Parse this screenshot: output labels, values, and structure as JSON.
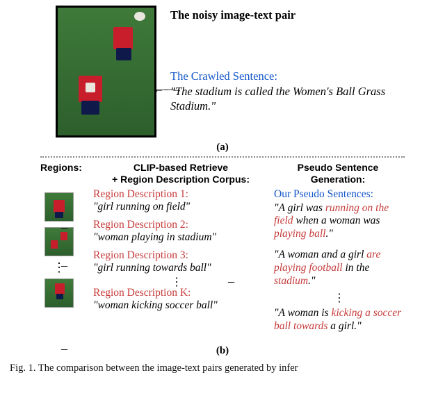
{
  "partA": {
    "title": "The noisy image-text pair",
    "crawled_label": "The Crawled Sentence:",
    "crawled_text": "\"The stadium is called the Women's Ball Grass Stadium.\"",
    "label": "(a)"
  },
  "headers": {
    "regions": "Regions:",
    "mid_line1": "CLIP-based Retrieve",
    "mid_line2": "+ Region Description Corpus:",
    "right_line1": "Pseudo Sentence",
    "right_line2": "Generation:"
  },
  "region_descriptions": [
    {
      "label": "Region Description 1:",
      "text": "\"girl running on field\""
    },
    {
      "label": "Region Description 2:",
      "text": "\"woman playing in stadium\""
    },
    {
      "label": "Region Description 3:",
      "text": "\"girl running towards ball\""
    },
    {
      "label": "Region Description K:",
      "text": "\"woman kicking soccer ball\""
    }
  ],
  "pseudo": {
    "label": "Our Pseudo Sentences:",
    "items": [
      {
        "parts": [
          "\"A girl was ",
          "running on the field",
          " when a woman was ",
          "playing ball",
          ".\""
        ]
      },
      {
        "parts": [
          "\"A woman and a girl ",
          "are playing football",
          " in the ",
          "stadium",
          ".\""
        ]
      },
      {
        "parts": [
          "\"A woman is ",
          "kicking a soccer ball towards",
          " a girl.\""
        ]
      }
    ]
  },
  "partB_label": "(b)",
  "caption_prefix": "Fig. 1.",
  "caption_text": "The comparison between the image-text pairs generated by infer"
}
